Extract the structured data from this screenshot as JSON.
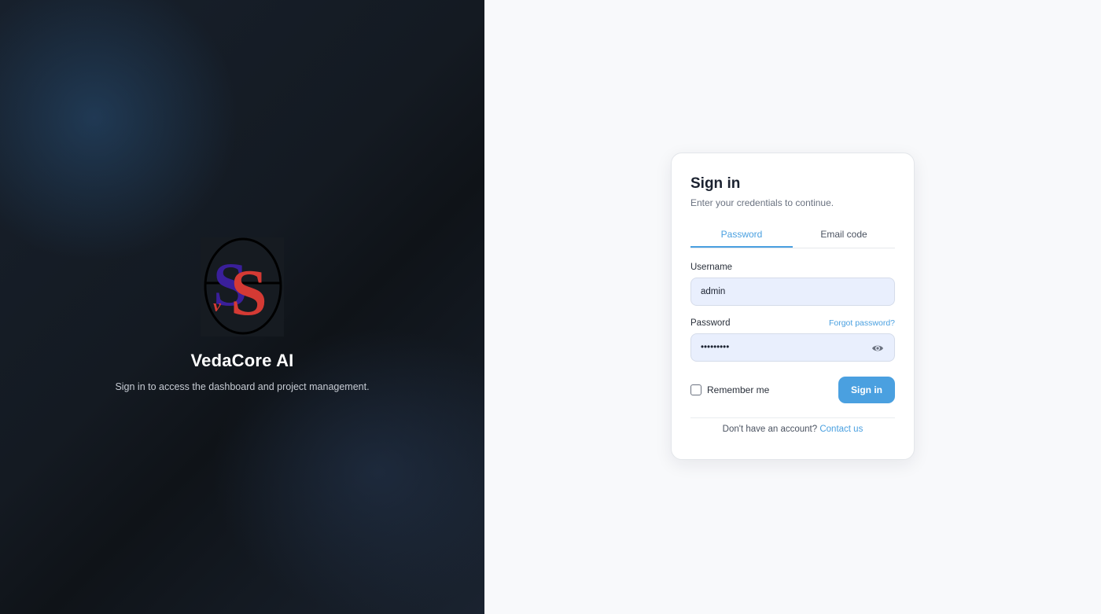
{
  "brand": {
    "name": "VedaCore AI",
    "tagline": "Sign in to access the dashboard and project management.",
    "logo_icon": "vs-logo-icon"
  },
  "signin": {
    "title": "Sign in",
    "subtitle": "Enter your credentials to continue.",
    "tabs": [
      {
        "label": "Password",
        "active": true
      },
      {
        "label": "Email code",
        "active": false
      }
    ],
    "username_label": "Username",
    "username_value": "admin",
    "password_label": "Password",
    "password_value": "•••••••••",
    "forgot_label": "Forgot password?",
    "show_password_icon": "eye-icon",
    "remember_label": "Remember me",
    "remember_checked": false,
    "submit_label": "Sign in",
    "footer_text": "Don't have an account?",
    "footer_link": "Contact us"
  },
  "colors": {
    "accent": "#4aa0e0",
    "input_bg": "#e9effd",
    "left_panel": "#141a22"
  }
}
